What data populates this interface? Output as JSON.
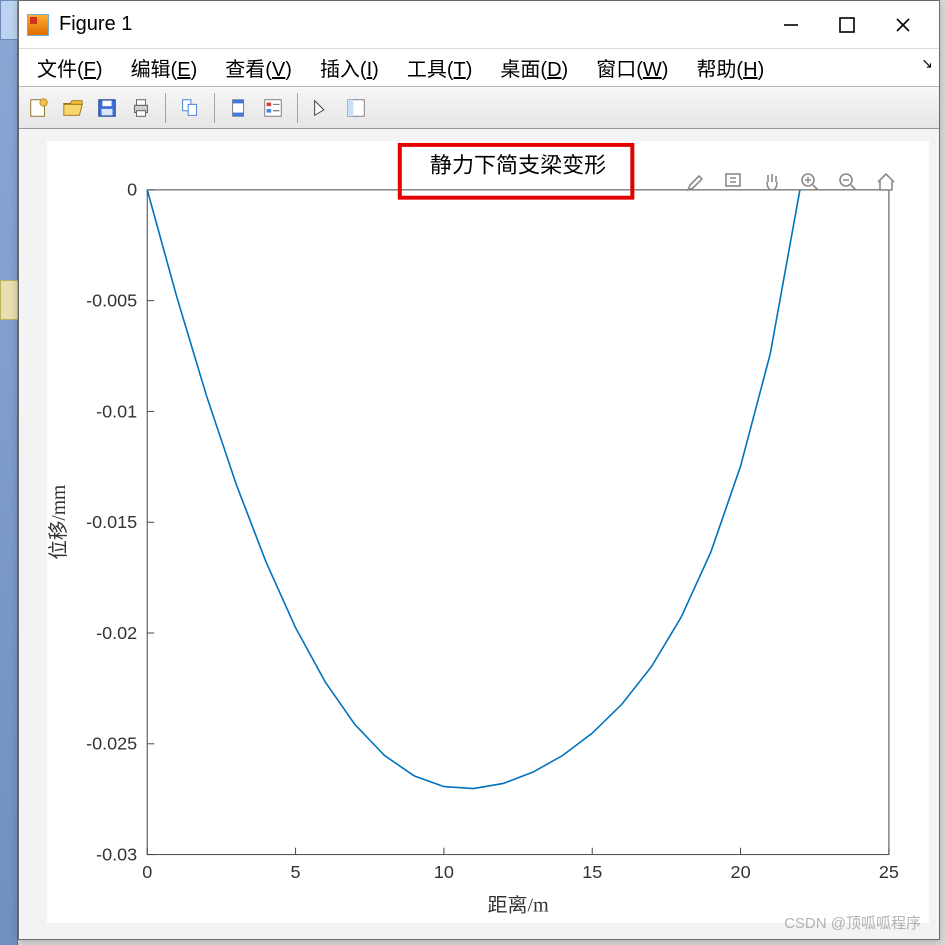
{
  "window": {
    "title": "Figure 1"
  },
  "menubar": {
    "items": [
      {
        "label": "文件",
        "hot": "F"
      },
      {
        "label": "编辑",
        "hot": "E"
      },
      {
        "label": "查看",
        "hot": "V"
      },
      {
        "label": "插入",
        "hot": "I"
      },
      {
        "label": "工具",
        "hot": "T"
      },
      {
        "label": "桌面",
        "hot": "D"
      },
      {
        "label": "窗口",
        "hot": "W"
      },
      {
        "label": "帮助",
        "hot": "H"
      }
    ]
  },
  "toolbar": {
    "items": [
      "new-figure",
      "open",
      "save",
      "print",
      "|",
      "link",
      "|",
      "colormap",
      "legend",
      "|",
      "pointer",
      "datacursor"
    ]
  },
  "figure_toolbar": {
    "items": [
      "brush",
      "data-tips",
      "pan",
      "zoom-in",
      "zoom-out",
      "home"
    ]
  },
  "watermark": "CSDN @顶呱呱程序",
  "chart_data": {
    "type": "line",
    "title": "静力下简支梁变形",
    "xlabel": "距离/m",
    "ylabel": "位移/mm",
    "xlim": [
      0,
      25
    ],
    "ylim": [
      -0.03,
      0
    ],
    "xticks": [
      0,
      5,
      10,
      15,
      20,
      25
    ],
    "yticks": [
      0,
      -0.005,
      -0.01,
      -0.015,
      -0.02,
      -0.025,
      -0.03
    ],
    "x": [
      0,
      1,
      2,
      3,
      4,
      5,
      6,
      7,
      8,
      9,
      10,
      11,
      12,
      13,
      14,
      15,
      16,
      17,
      18,
      19,
      20,
      21,
      22
    ],
    "values": [
      0.0,
      -0.00485,
      -0.0093,
      -0.01329,
      -0.01678,
      -0.01976,
      -0.02221,
      -0.02413,
      -0.02553,
      -0.02645,
      -0.02693,
      -0.02702,
      -0.02679,
      -0.02628,
      -0.02553,
      -0.02452,
      -0.02321,
      -0.02151,
      -0.01928,
      -0.01634,
      -0.01247,
      -0.0074,
      0.0
    ],
    "line_color": "#0072bd"
  }
}
